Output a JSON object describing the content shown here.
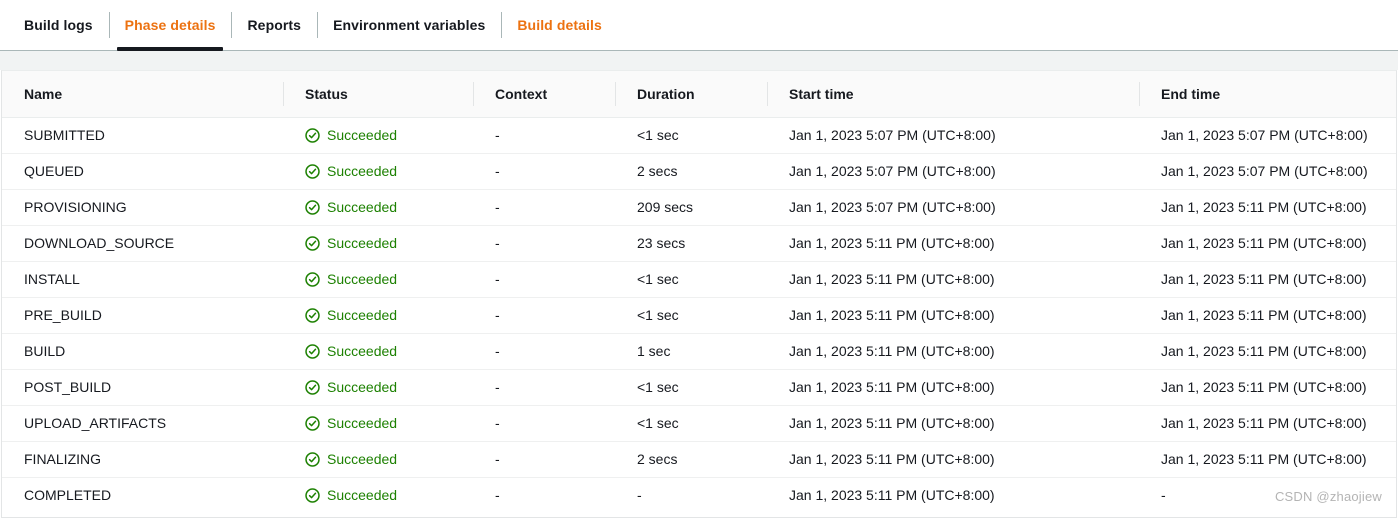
{
  "tabs": [
    {
      "label": "Build logs",
      "state": "normal"
    },
    {
      "label": "Phase details",
      "state": "active"
    },
    {
      "label": "Reports",
      "state": "normal"
    },
    {
      "label": "Environment variables",
      "state": "normal"
    },
    {
      "label": "Build details",
      "state": "link"
    }
  ],
  "table": {
    "columns": [
      {
        "key": "name",
        "label": "Name"
      },
      {
        "key": "status",
        "label": "Status"
      },
      {
        "key": "context",
        "label": "Context"
      },
      {
        "key": "duration",
        "label": "Duration"
      },
      {
        "key": "start_time",
        "label": "Start time"
      },
      {
        "key": "end_time",
        "label": "End time"
      }
    ],
    "rows": [
      {
        "name": "SUBMITTED",
        "status": "Succeeded",
        "status_icon": "check-circle-icon",
        "context": "-",
        "duration": "<1 sec",
        "start_time": "Jan 1, 2023 5:07 PM (UTC+8:00)",
        "end_time": "Jan 1, 2023 5:07 PM (UTC+8:00)"
      },
      {
        "name": "QUEUED",
        "status": "Succeeded",
        "status_icon": "check-circle-icon",
        "context": "-",
        "duration": "2 secs",
        "start_time": "Jan 1, 2023 5:07 PM (UTC+8:00)",
        "end_time": "Jan 1, 2023 5:07 PM (UTC+8:00)"
      },
      {
        "name": "PROVISIONING",
        "status": "Succeeded",
        "status_icon": "check-circle-icon",
        "context": "-",
        "duration": "209 secs",
        "start_time": "Jan 1, 2023 5:07 PM (UTC+8:00)",
        "end_time": "Jan 1, 2023 5:11 PM (UTC+8:00)"
      },
      {
        "name": "DOWNLOAD_SOURCE",
        "status": "Succeeded",
        "status_icon": "check-circle-icon",
        "context": "-",
        "duration": "23 secs",
        "start_time": "Jan 1, 2023 5:11 PM (UTC+8:00)",
        "end_time": "Jan 1, 2023 5:11 PM (UTC+8:00)"
      },
      {
        "name": "INSTALL",
        "status": "Succeeded",
        "status_icon": "check-circle-icon",
        "context": "-",
        "duration": "<1 sec",
        "start_time": "Jan 1, 2023 5:11 PM (UTC+8:00)",
        "end_time": "Jan 1, 2023 5:11 PM (UTC+8:00)"
      },
      {
        "name": "PRE_BUILD",
        "status": "Succeeded",
        "status_icon": "check-circle-icon",
        "context": "-",
        "duration": "<1 sec",
        "start_time": "Jan 1, 2023 5:11 PM (UTC+8:00)",
        "end_time": "Jan 1, 2023 5:11 PM (UTC+8:00)"
      },
      {
        "name": "BUILD",
        "status": "Succeeded",
        "status_icon": "check-circle-icon",
        "context": "-",
        "duration": "1 sec",
        "start_time": "Jan 1, 2023 5:11 PM (UTC+8:00)",
        "end_time": "Jan 1, 2023 5:11 PM (UTC+8:00)"
      },
      {
        "name": "POST_BUILD",
        "status": "Succeeded",
        "status_icon": "check-circle-icon",
        "context": "-",
        "duration": "<1 sec",
        "start_time": "Jan 1, 2023 5:11 PM (UTC+8:00)",
        "end_time": "Jan 1, 2023 5:11 PM (UTC+8:00)"
      },
      {
        "name": "UPLOAD_ARTIFACTS",
        "status": "Succeeded",
        "status_icon": "check-circle-icon",
        "context": "-",
        "duration": "<1 sec",
        "start_time": "Jan 1, 2023 5:11 PM (UTC+8:00)",
        "end_time": "Jan 1, 2023 5:11 PM (UTC+8:00)"
      },
      {
        "name": "FINALIZING",
        "status": "Succeeded",
        "status_icon": "check-circle-icon",
        "context": "-",
        "duration": "2 secs",
        "start_time": "Jan 1, 2023 5:11 PM (UTC+8:00)",
        "end_time": "Jan 1, 2023 5:11 PM (UTC+8:00)"
      },
      {
        "name": "COMPLETED",
        "status": "Succeeded",
        "status_icon": "check-circle-icon",
        "context": "-",
        "duration": "-",
        "start_time": "Jan 1, 2023 5:11 PM (UTC+8:00)",
        "end_time": "-"
      }
    ]
  },
  "watermark": {
    "text": "CSDN @zhaojiew"
  },
  "colors": {
    "accent_orange": "#ec7211",
    "active_underline": "#16191f",
    "success_green": "#1d8102",
    "text_primary": "#16191f",
    "header_bg": "#fafafa",
    "gap_bg": "#f1f3f3",
    "border": "#e3e5e6"
  }
}
